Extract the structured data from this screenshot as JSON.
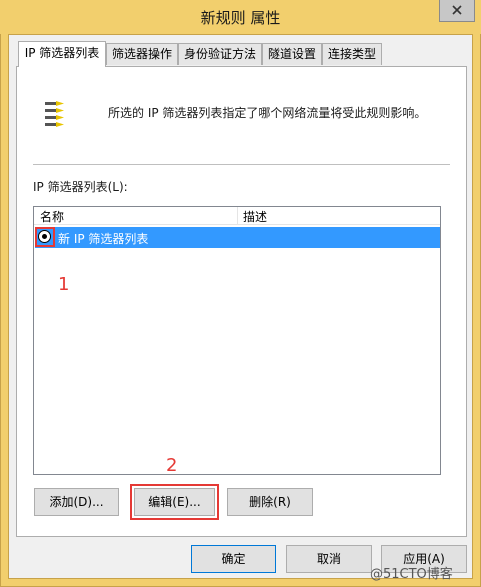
{
  "window": {
    "title": "新规则 属性"
  },
  "tabs": [
    {
      "label": "IP 筛选器列表"
    },
    {
      "label": "筛选器操作"
    },
    {
      "label": "身份验证方法"
    },
    {
      "label": "隧道设置"
    },
    {
      "label": "连接类型"
    }
  ],
  "panel": {
    "description": "所选的 IP 筛选器列表指定了哪个网络流量将受此规则影响。",
    "list_label": "IP 筛选器列表(L):",
    "columns": {
      "name": "名称",
      "description": "描述"
    },
    "rows": [
      {
        "name": "新 IP 筛选器列表",
        "description": "",
        "selected": true
      }
    ]
  },
  "buttons": {
    "add": "添加(D)...",
    "edit": "编辑(E)...",
    "delete": "删除(R)",
    "ok": "确定",
    "cancel": "取消",
    "apply": "应用(A)"
  },
  "annotations": {
    "one": "1",
    "two": "2"
  },
  "watermark": "@51CTO博客",
  "colors": {
    "title_bar": "#f2cf6d",
    "selection": "#3399ff",
    "annotation": "#e53935"
  },
  "icons": {
    "close": "close-icon",
    "filter_list": "filter-list-icon"
  }
}
